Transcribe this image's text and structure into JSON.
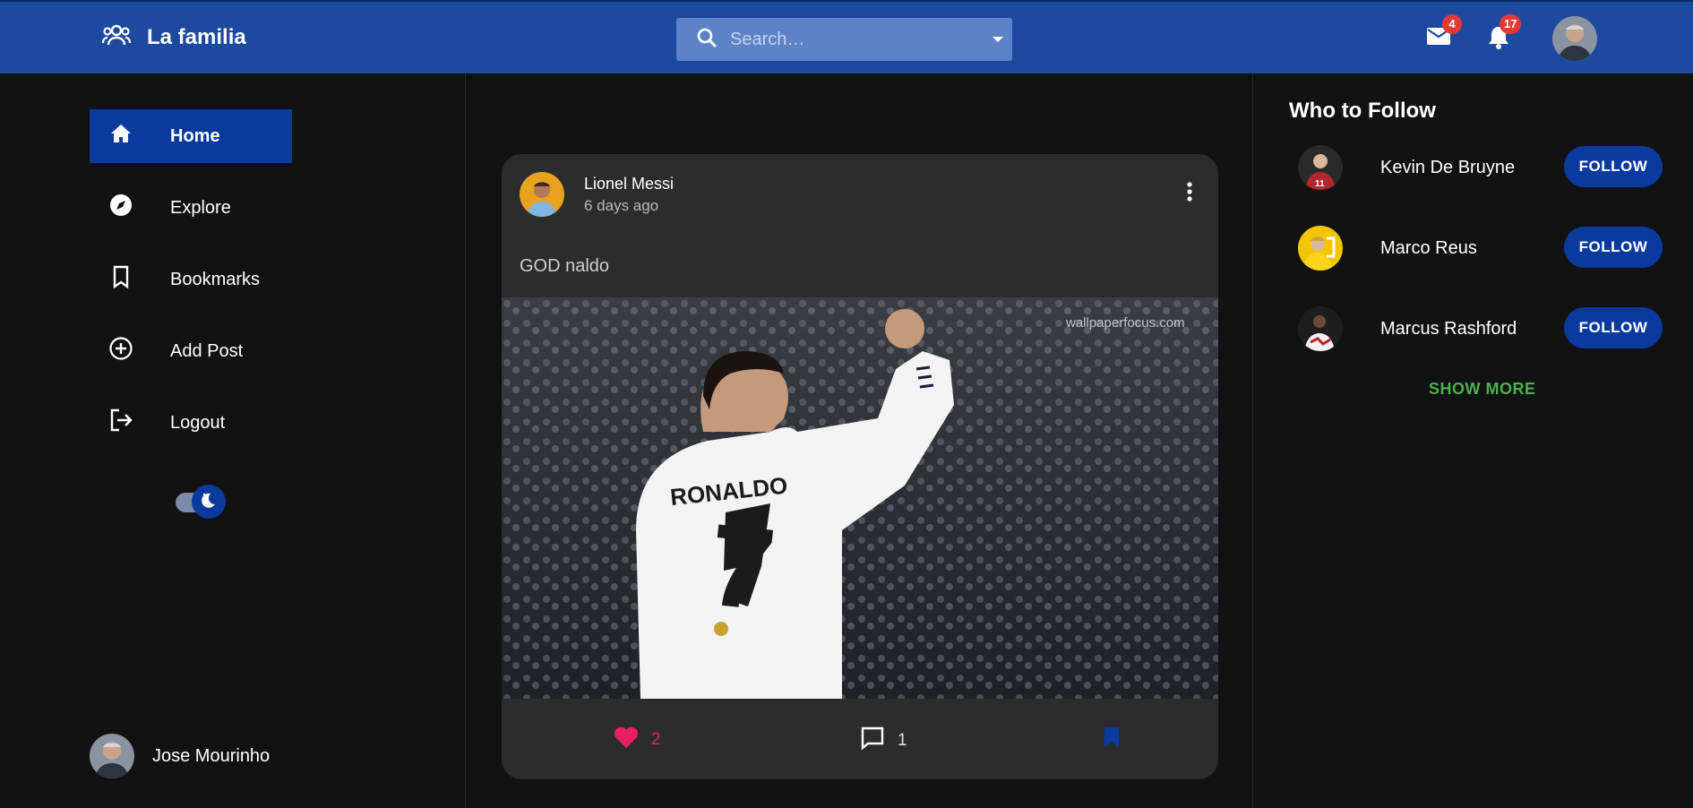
{
  "header": {
    "brand_title": "La familia",
    "search_placeholder": "Search…",
    "mail_badge": "4",
    "notifications_badge": "17"
  },
  "sidebar": {
    "items": [
      {
        "label": "Home",
        "icon": "home-icon",
        "active": true
      },
      {
        "label": "Explore",
        "icon": "compass-icon"
      },
      {
        "label": "Bookmarks",
        "icon": "bookmark-icon"
      },
      {
        "label": "Add Post",
        "icon": "add-circle-icon"
      },
      {
        "label": "Logout",
        "icon": "logout-icon"
      }
    ],
    "current_user": "Jose Mourinho"
  },
  "post": {
    "author": "Lionel Messi",
    "time": "6 days ago",
    "text": "GOD naldo",
    "image_watermark": "wallpaperfocus.com",
    "jersey_name": "RONALDO",
    "jersey_number": "7",
    "likes": "2",
    "comments": "1"
  },
  "who_to_follow": {
    "title": "Who to Follow",
    "users": [
      {
        "name": "Kevin De Bruyne",
        "button": "FOLLOW"
      },
      {
        "name": "Marco Reus",
        "button": "FOLLOW"
      },
      {
        "name": "Marcus Rashford",
        "button": "FOLLOW"
      }
    ],
    "show_more": "SHOW MORE"
  },
  "colors": {
    "header": "#1d4aa0",
    "accent": "#0b3a9e",
    "like": "#e91e63",
    "show_more": "#4caf50",
    "badge": "#e53935"
  }
}
